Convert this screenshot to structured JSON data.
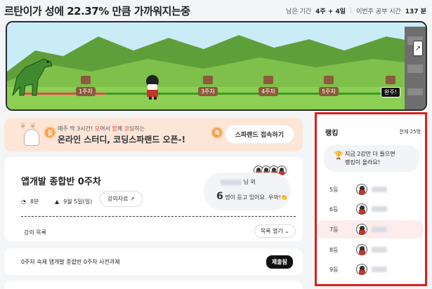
{
  "header": {
    "headline": "르탄이가 성에 22.37% 만큼 가까워지는중",
    "remaining_label": "남은 기간",
    "remaining_value": "4주 + 4일",
    "study_label": "이번주 공부 시간",
    "study_value": "137 분",
    "progress_percent": 22.37
  },
  "game": {
    "weeks": [
      "1주차",
      "2주차",
      "3주차",
      "4주차",
      "5주차"
    ],
    "final_label": "완주!",
    "castle_icon": "arrow-icon",
    "colors": {
      "sky": "#c9ecf7",
      "hill_dark": "#5f9f3a",
      "hill_light": "#7fc04b",
      "progress_red": "#e24a4a",
      "track_green": "#3e9b22"
    }
  },
  "banner": {
    "small_prefix": "매주 딱 3시간! ",
    "small_h1": "모",
    "small_mid": "여서 ",
    "small_h2": "함",
    "small_mid2": "께 ",
    "small_h3": "코",
    "small_suffix": "딩하는",
    "big_text": "온라인 스터디, 코딩스파랜드 오픈-!",
    "badge_left": "걸",
    "badge_right": "축",
    "cta_label": "스파랜드 접속하기"
  },
  "course": {
    "title": "앱개발 종합반 0주차",
    "duration": "8분",
    "date": "9월 5일(일)",
    "material_label": "강의자료 ↗",
    "listeners_suffix": "님 외",
    "listeners_count": "6",
    "listeners_text": "명이 듣고 있어요. 우와!👏",
    "lecture_list_label": "강의 목록",
    "open_list_label": "목록 열기 ⌄"
  },
  "homework": {
    "text": "0주차 숙제 앱개발 종합반 0주차 사전과제",
    "submit_label": "제출됨"
  },
  "ranking": {
    "title": "랭킹",
    "total": "전체 25명",
    "message_line1": "지금 2강만 더 들으면",
    "message_line2": "랭킹이 올라요!",
    "rows": [
      {
        "rank": "5등"
      },
      {
        "rank": "6등"
      },
      {
        "rank": "7등",
        "me": true
      },
      {
        "rank": "8등"
      },
      {
        "rank": "9등"
      }
    ]
  }
}
